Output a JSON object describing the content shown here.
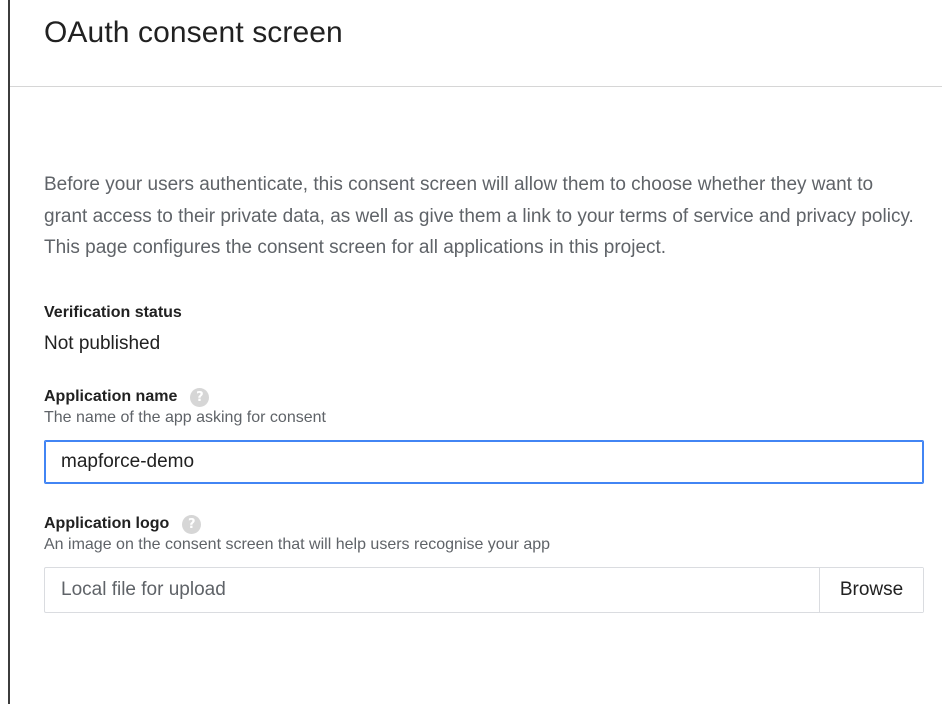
{
  "header": {
    "title": "OAuth consent screen"
  },
  "intro": "Before your users authenticate, this consent screen will allow them to choose whether they want to grant access to their private data, as well as give them a link to your terms of service and privacy policy. This page configures the consent screen for all applications in this project.",
  "verification": {
    "label": "Verification status",
    "value": "Not published"
  },
  "application_name": {
    "label": "Application name",
    "help_icon": "question-mark-icon",
    "description": "The name of the app asking for consent",
    "value": "mapforce-demo"
  },
  "application_logo": {
    "label": "Application logo",
    "help_icon": "question-mark-icon",
    "description": "An image on the consent screen that will help users recognise your app",
    "placeholder": "Local file for upload",
    "browse_label": "Browse"
  },
  "colors": {
    "accent": "#4285f4",
    "help_icon": "#d6d6d6"
  }
}
